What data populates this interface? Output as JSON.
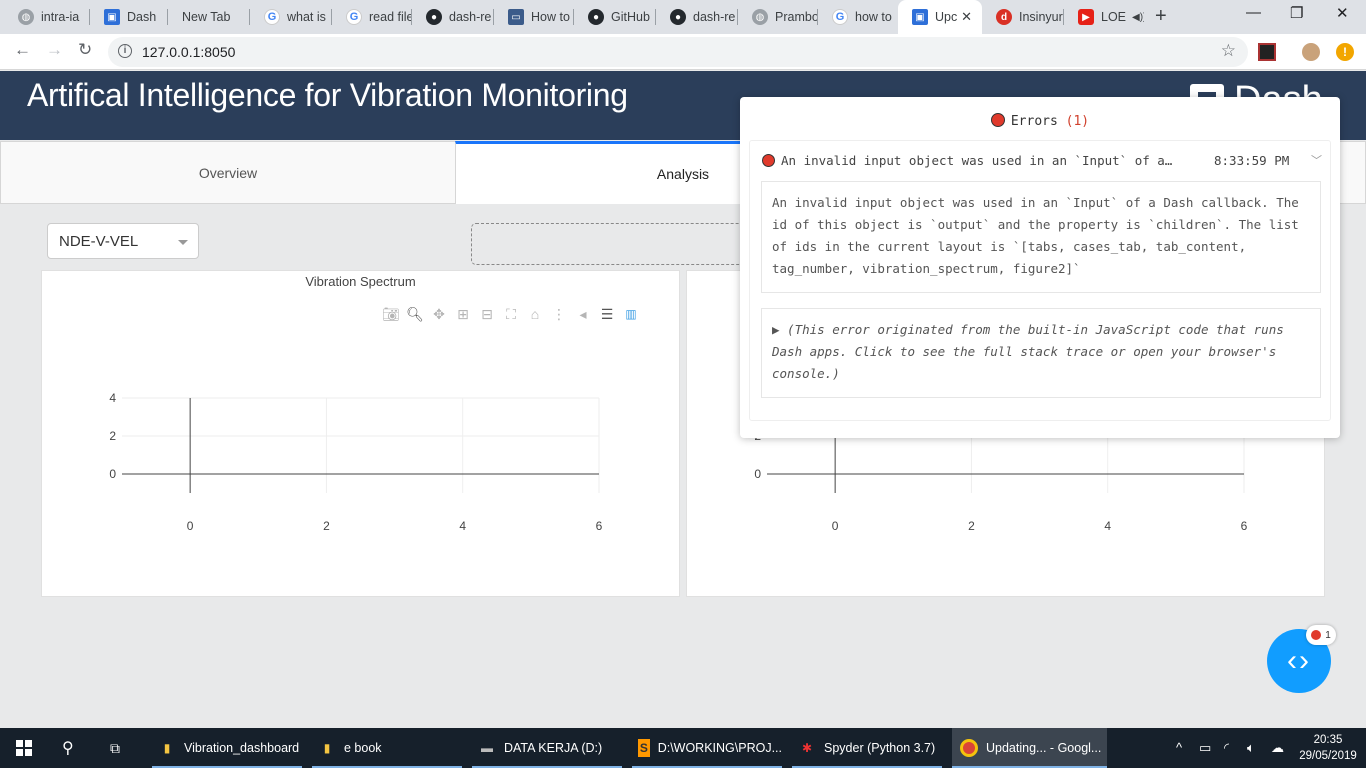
{
  "browser": {
    "tabs": [
      {
        "title": "intra-ia",
        "icon": "globe-icon"
      },
      {
        "title": "Dash",
        "icon": "dash-icon"
      },
      {
        "title": "New Tab",
        "icon": ""
      },
      {
        "title": "what is",
        "icon": "google-icon"
      },
      {
        "title": "read file",
        "icon": "google-icon"
      },
      {
        "title": "dash-re",
        "icon": "github-icon"
      },
      {
        "title": "How to",
        "icon": "monitor-icon"
      },
      {
        "title": "GitHub",
        "icon": "github-icon"
      },
      {
        "title": "dash-re",
        "icon": "github-icon"
      },
      {
        "title": "Prambo",
        "icon": "globe-icon"
      },
      {
        "title": "how to",
        "icon": "google-icon"
      },
      {
        "title": "Upc",
        "icon": "dash-icon"
      },
      {
        "title": "Insinyur",
        "icon": "d-icon"
      },
      {
        "title": "LOE",
        "icon": "youtube-icon"
      }
    ],
    "url": "127.0.0.1:8050"
  },
  "app": {
    "title": "Artifical Intelligence for Vibration Monitoring",
    "logo_text": "Dash",
    "tabs": [
      {
        "label": "Overview"
      },
      {
        "label": "Analysis"
      }
    ],
    "dropdown_value": "NDE-V-VEL",
    "graph_left_title": "Vibration Spectrum"
  },
  "chart_data": [
    {
      "type": "line",
      "title": "Vibration Spectrum",
      "x_ticks": [
        0,
        2,
        4,
        6
      ],
      "y_ticks": [
        0,
        2,
        4
      ],
      "xlim": [
        -1,
        6
      ],
      "ylim": [
        -1,
        4
      ],
      "series": []
    },
    {
      "type": "line",
      "title": "",
      "x_ticks": [
        0,
        2,
        4,
        6
      ],
      "y_ticks": [
        0,
        2
      ],
      "xlim": [
        -1,
        6
      ],
      "ylim": [
        -1,
        4
      ],
      "series": []
    }
  ],
  "errors": {
    "header_label": "Errors",
    "count": "(1)",
    "summary": "An invalid input object was used in an `Input` of a…",
    "time": "8:33:59 PM",
    "detail": "An invalid input object was used in an `Input` of a Dash callback. The id of this object is `output` and the property is `children`. The list of ids in the current layout is `[tabs, cases_tab, tab_content, tag_number, vibration_spectrum, figure2]`",
    "trace": "▶ (This error originated from the built-in JavaScript code that runs Dash apps. Click to see the full stack trace or open your browser's console.)",
    "badge_count": "1"
  },
  "taskbar": {
    "items": [
      {
        "label": "Vibration_dashboard",
        "icon": "folder-icon"
      },
      {
        "label": "e book",
        "icon": "folder-icon"
      },
      {
        "label": "DATA KERJA (D:)",
        "icon": "drive-icon"
      },
      {
        "label": "D:\\WORKING\\PROJ...",
        "icon": "sublime-icon"
      },
      {
        "label": "Spyder (Python 3.7)",
        "icon": "spyder-icon"
      },
      {
        "label": "Updating... - Googl...",
        "icon": "chrome-icon"
      }
    ],
    "time": "20:35",
    "date": "29/05/2019"
  },
  "colors": {
    "banner": "#2b3e5a",
    "accent": "#1975fa",
    "dev_button": "#119dff",
    "error_red": "#e03a2c"
  }
}
